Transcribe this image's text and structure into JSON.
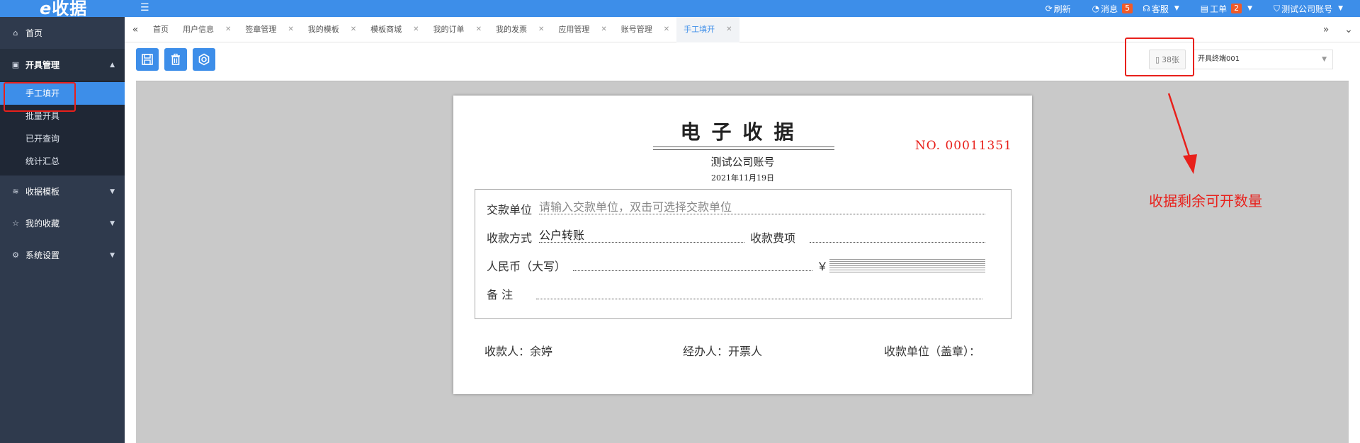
{
  "app": {
    "logo_text": "收据",
    "logo_prefix": "e"
  },
  "topbar": {
    "menu_icon": "list-toggle-icon",
    "refresh_label": "刷新",
    "messages_label": "消息",
    "messages_count": "5",
    "support_label": "客服",
    "ticket_label": "工单",
    "ticket_count": "2",
    "account_label": "测试公司账号"
  },
  "sidebar": {
    "home_label": "首页",
    "issue_mgmt_label": "开具管理",
    "sub_items": [
      "手工填开",
      "批量开具",
      "已开查询",
      "统计汇总"
    ],
    "template_label": "收据模板",
    "favorites_label": "我的收藏",
    "settings_label": "系统设置"
  },
  "tabs": [
    {
      "label": "首页",
      "closable": false
    },
    {
      "label": "用户信息",
      "closable": true
    },
    {
      "label": "签章管理",
      "closable": true
    },
    {
      "label": "我的模板",
      "closable": true
    },
    {
      "label": "模板商城",
      "closable": true
    },
    {
      "label": "我的订单",
      "closable": true
    },
    {
      "label": "我的发票",
      "closable": true
    },
    {
      "label": "应用管理",
      "closable": true
    },
    {
      "label": "账号管理",
      "closable": true
    },
    {
      "label": "手工填开",
      "closable": true,
      "active": true
    }
  ],
  "toolbar": {
    "remaining_count": "38张",
    "terminal_value": "开具终端001"
  },
  "annotation": {
    "text": "收据剩余可开数量"
  },
  "receipt": {
    "title": "电子收据",
    "company": "测试公司账号",
    "date": "2021年11月19日",
    "number": "NO. 00011351",
    "payer_label": "交款单位",
    "payer_placeholder": "请输入交款单位，双击可选择交款单位",
    "method_label": "收款方式",
    "method_value": "公户转账",
    "fee_label": "收款费项",
    "fee_value": "",
    "rmb_label": "人民币（大写）",
    "rmb_value": "",
    "yen_symbol": "￥",
    "remark_label": "备    注",
    "remark_value": "",
    "receiver_label": "收款人：余婷",
    "handler_label": "经办人：开票人",
    "unit_label": "收款单位（盖章）："
  },
  "colors": {
    "primary": "#3d8ee9",
    "sidebar_bg": "#2f3a4d",
    "highlight_red": "#e8201b"
  }
}
